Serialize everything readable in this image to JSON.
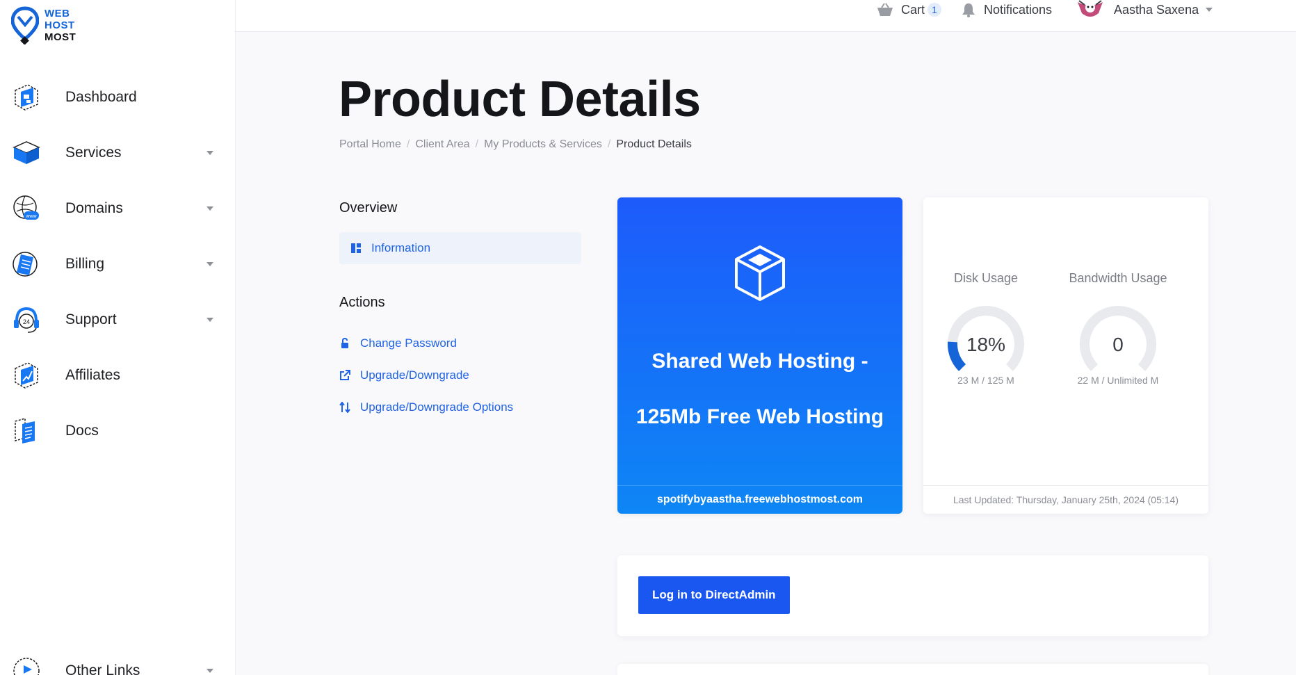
{
  "logo": {
    "line1": "WEB",
    "line2": "HOST",
    "line3": "MOST"
  },
  "sidebar": {
    "items": [
      {
        "label": "Dashboard",
        "icon": "dashboard-icon",
        "has_caret": false
      },
      {
        "label": "Services",
        "icon": "services-icon",
        "has_caret": true
      },
      {
        "label": "Domains",
        "icon": "domains-icon",
        "has_caret": true
      },
      {
        "label": "Billing",
        "icon": "billing-icon",
        "has_caret": true
      },
      {
        "label": "Support",
        "icon": "support-icon",
        "has_caret": true
      },
      {
        "label": "Affiliates",
        "icon": "affiliates-icon",
        "has_caret": false
      },
      {
        "label": "Docs",
        "icon": "docs-icon",
        "has_caret": false
      }
    ],
    "bottom_item": {
      "label": "Other Links",
      "icon": "other-links-icon"
    }
  },
  "topbar": {
    "cart_label": "Cart",
    "cart_count": "1",
    "notifications_label": "Notifications",
    "user_name": "Aastha Saxena"
  },
  "page": {
    "title": "Product Details",
    "breadcrumb": [
      "Portal Home",
      "Client Area",
      "My Products & Services",
      "Product Details"
    ]
  },
  "overview": {
    "heading": "Overview",
    "items": [
      {
        "label": "Information",
        "icon": "dashboard-grid-icon"
      }
    ]
  },
  "actions": {
    "heading": "Actions",
    "items": [
      {
        "label": "Change Password",
        "icon": "unlock-icon"
      },
      {
        "label": "Upgrade/Downgrade",
        "icon": "external-link-icon"
      },
      {
        "label": "Upgrade/Downgrade Options",
        "icon": "sort-arrows-icon"
      }
    ]
  },
  "product": {
    "name_line1": "Shared Web Hosting -",
    "name_line2": "125Mb Free Web Hosting",
    "domain": "spotifybyaastha.freewebhostmost.com",
    "gradient_top": "#1d5bfb",
    "gradient_bottom": "#0e86f5"
  },
  "usage": {
    "disk": {
      "title": "Disk Usage",
      "value": "18%",
      "percent": 18,
      "detail": "23 M / 125 M"
    },
    "bandwidth": {
      "title": "Bandwidth Usage",
      "value": "0",
      "percent": 0,
      "detail": "22 M / Unlimited M"
    },
    "last_updated": "Last Updated: Thursday, January 25th, 2024 (05:14)",
    "accent": "#1565d8",
    "track": "#e9eaee"
  },
  "login": {
    "button_label": "Log in to DirectAdmin"
  }
}
